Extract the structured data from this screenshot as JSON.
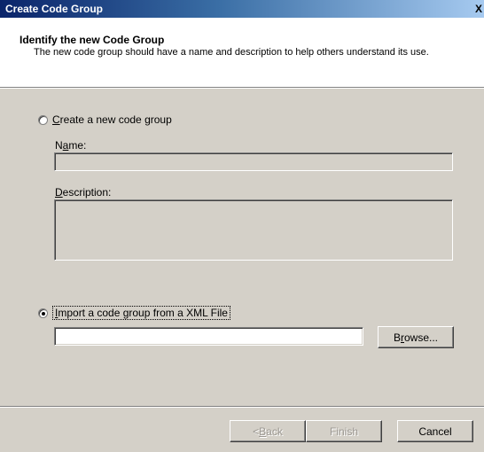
{
  "window": {
    "title": "Create Code Group",
    "close_glyph": "X"
  },
  "header": {
    "title": "Identify the new Code Group",
    "subtitle": "The new code group should have a name and description to help others understand its use."
  },
  "options": {
    "create_new": {
      "label_accel": "C",
      "label_rest": "reate a new code group",
      "selected": false,
      "name_label_pre": "N",
      "name_label_accel": "a",
      "name_label_rest": "me:",
      "name_value": "",
      "description_label_accel": "D",
      "description_label_rest": "escription:",
      "description_value": ""
    },
    "import_xml": {
      "label_accel": "I",
      "label_rest": "mport a code group from a XML File",
      "selected": true,
      "file_value": "",
      "browse_pre": "B",
      "browse_accel": "r",
      "browse_rest": "owse..."
    }
  },
  "footer": {
    "back_pre": "< ",
    "back_accel": "B",
    "back_rest": "ack",
    "finish_label": "Finish",
    "cancel_label": "Cancel"
  }
}
